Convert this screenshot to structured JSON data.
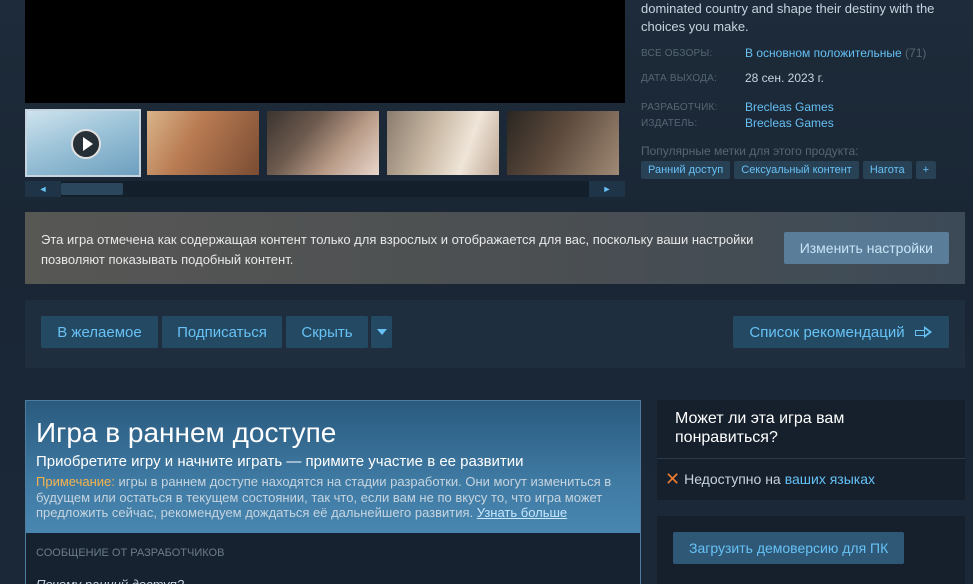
{
  "info": {
    "description": "dominated country and shape their destiny with the choices you make.",
    "reviews_label": "ВСЕ ОБЗОРЫ:",
    "reviews_value": "В основном положительные",
    "reviews_count": "(71)",
    "release_label": "ДАТА ВЫХОДА:",
    "release_value": "28 сен. 2023 г.",
    "developer_label": "РАЗРАБОТЧИК:",
    "developer_value": "Brecleas Games",
    "publisher_label": "ИЗДАТЕЛЬ:",
    "publisher_value": "Brecleas Games",
    "tags_label": "Популярные метки для этого продукта:",
    "tags": [
      "Ранний доступ",
      "Сексуальный контент",
      "Нагота",
      "+"
    ]
  },
  "media": {
    "slider_left": "◄",
    "slider_right": "►"
  },
  "mature": {
    "text": "Эта игра отмечена как содержащая контент только для взрослых и отображается для вас, поскольку ваши настройки позволяют показывать подобный контент.",
    "button": "Изменить настройки"
  },
  "actions": {
    "wishlist": "В желаемое",
    "follow": "Подписаться",
    "ignore": "Скрыть",
    "queue": "Список рекомендаций"
  },
  "early_access": {
    "title": "Игра в раннем доступе",
    "subtitle": "Приобретите игру и начните играть — примите участие в ее развитии",
    "note_label": "Примечание:",
    "note_text": " игры в раннем доступе находятся на стадии разработки. Они могут измениться в будущем или остаться в текущем состоянии, так что, если вам не по вкусу то, что игра может предложить сейчас, рекомендуем дождаться её дальнейшего развития. ",
    "note_link": "Узнать больше",
    "dev_message": "СООБЩЕНИЕ ОТ РАЗРАБОТЧИКОВ",
    "why": "Почему ранний доступ?"
  },
  "like_panel": {
    "title": "Может ли эта игра вам понравиться?",
    "unavailable": "Недоступно на",
    "languages_link": "ваших языках",
    "icon": "x-icon"
  },
  "demo": {
    "button": "Загрузить демоверсию для ПК"
  }
}
